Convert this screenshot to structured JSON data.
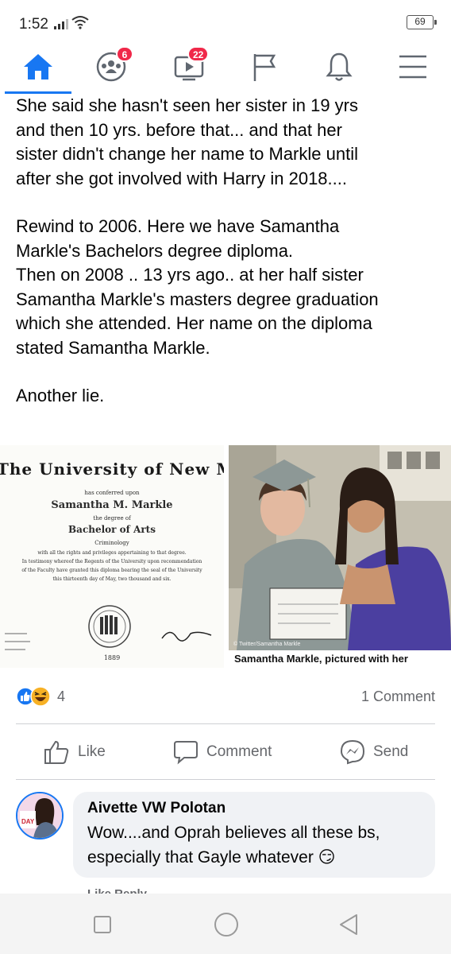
{
  "status_bar": {
    "time": "1:52",
    "battery": "69"
  },
  "nav": {
    "groups_badge": "6",
    "watch_badge": "22"
  },
  "post": {
    "paragraphs": [
      "She said she hasn't seen her sister in 19 yrs\nand then 10 yrs. before that... and that her\nsister didn't change her name to Markle until\nafter she got involved with Harry in 2018....",
      "Rewind to 2006. Here we have Samantha\nMarkle's Bachelors degree diploma.\nThen on 2008 .. 13 yrs ago..  at her half sister\nSamantha Markle's masters degree graduation\nwhich she attended. Her name on the diploma\nstated Samantha Markle.",
      "Another lie."
    ]
  },
  "diploma": {
    "title": "The University of New Mexico",
    "conferred": "has conferred upon",
    "name": "Samantha M. Markle",
    "degree_of": "the degree of",
    "degree": "Bachelor of Arts",
    "field": "Criminology",
    "line1": "with all the rights and privileges appertaining to that degree.",
    "line2": "In testimony whereof the Regents of the University upon recommendation",
    "line3": "of the Faculty have granted this diploma bearing the seal of the University",
    "line4": "this thirteenth day of May, two thousand and six.",
    "seal_year": "1889"
  },
  "photo": {
    "caption": "Samantha Markle, pictured with her",
    "credit": "© Twitter/Samantha Markle"
  },
  "reactions": {
    "count": "4",
    "comments": "1 Comment"
  },
  "actions": {
    "like": "Like",
    "comment": "Comment",
    "send": "Send"
  },
  "comment": {
    "author": "Aivette VW Polotan",
    "text": "Wow....and Oprah believes all these bs, especially that Gayle whatever 😏",
    "avatar_label": "DAY",
    "partial_actions": "Like    Reply"
  },
  "colors": {
    "brand": "#1877f2",
    "badge": "#f02849",
    "muted": "#65676b"
  }
}
